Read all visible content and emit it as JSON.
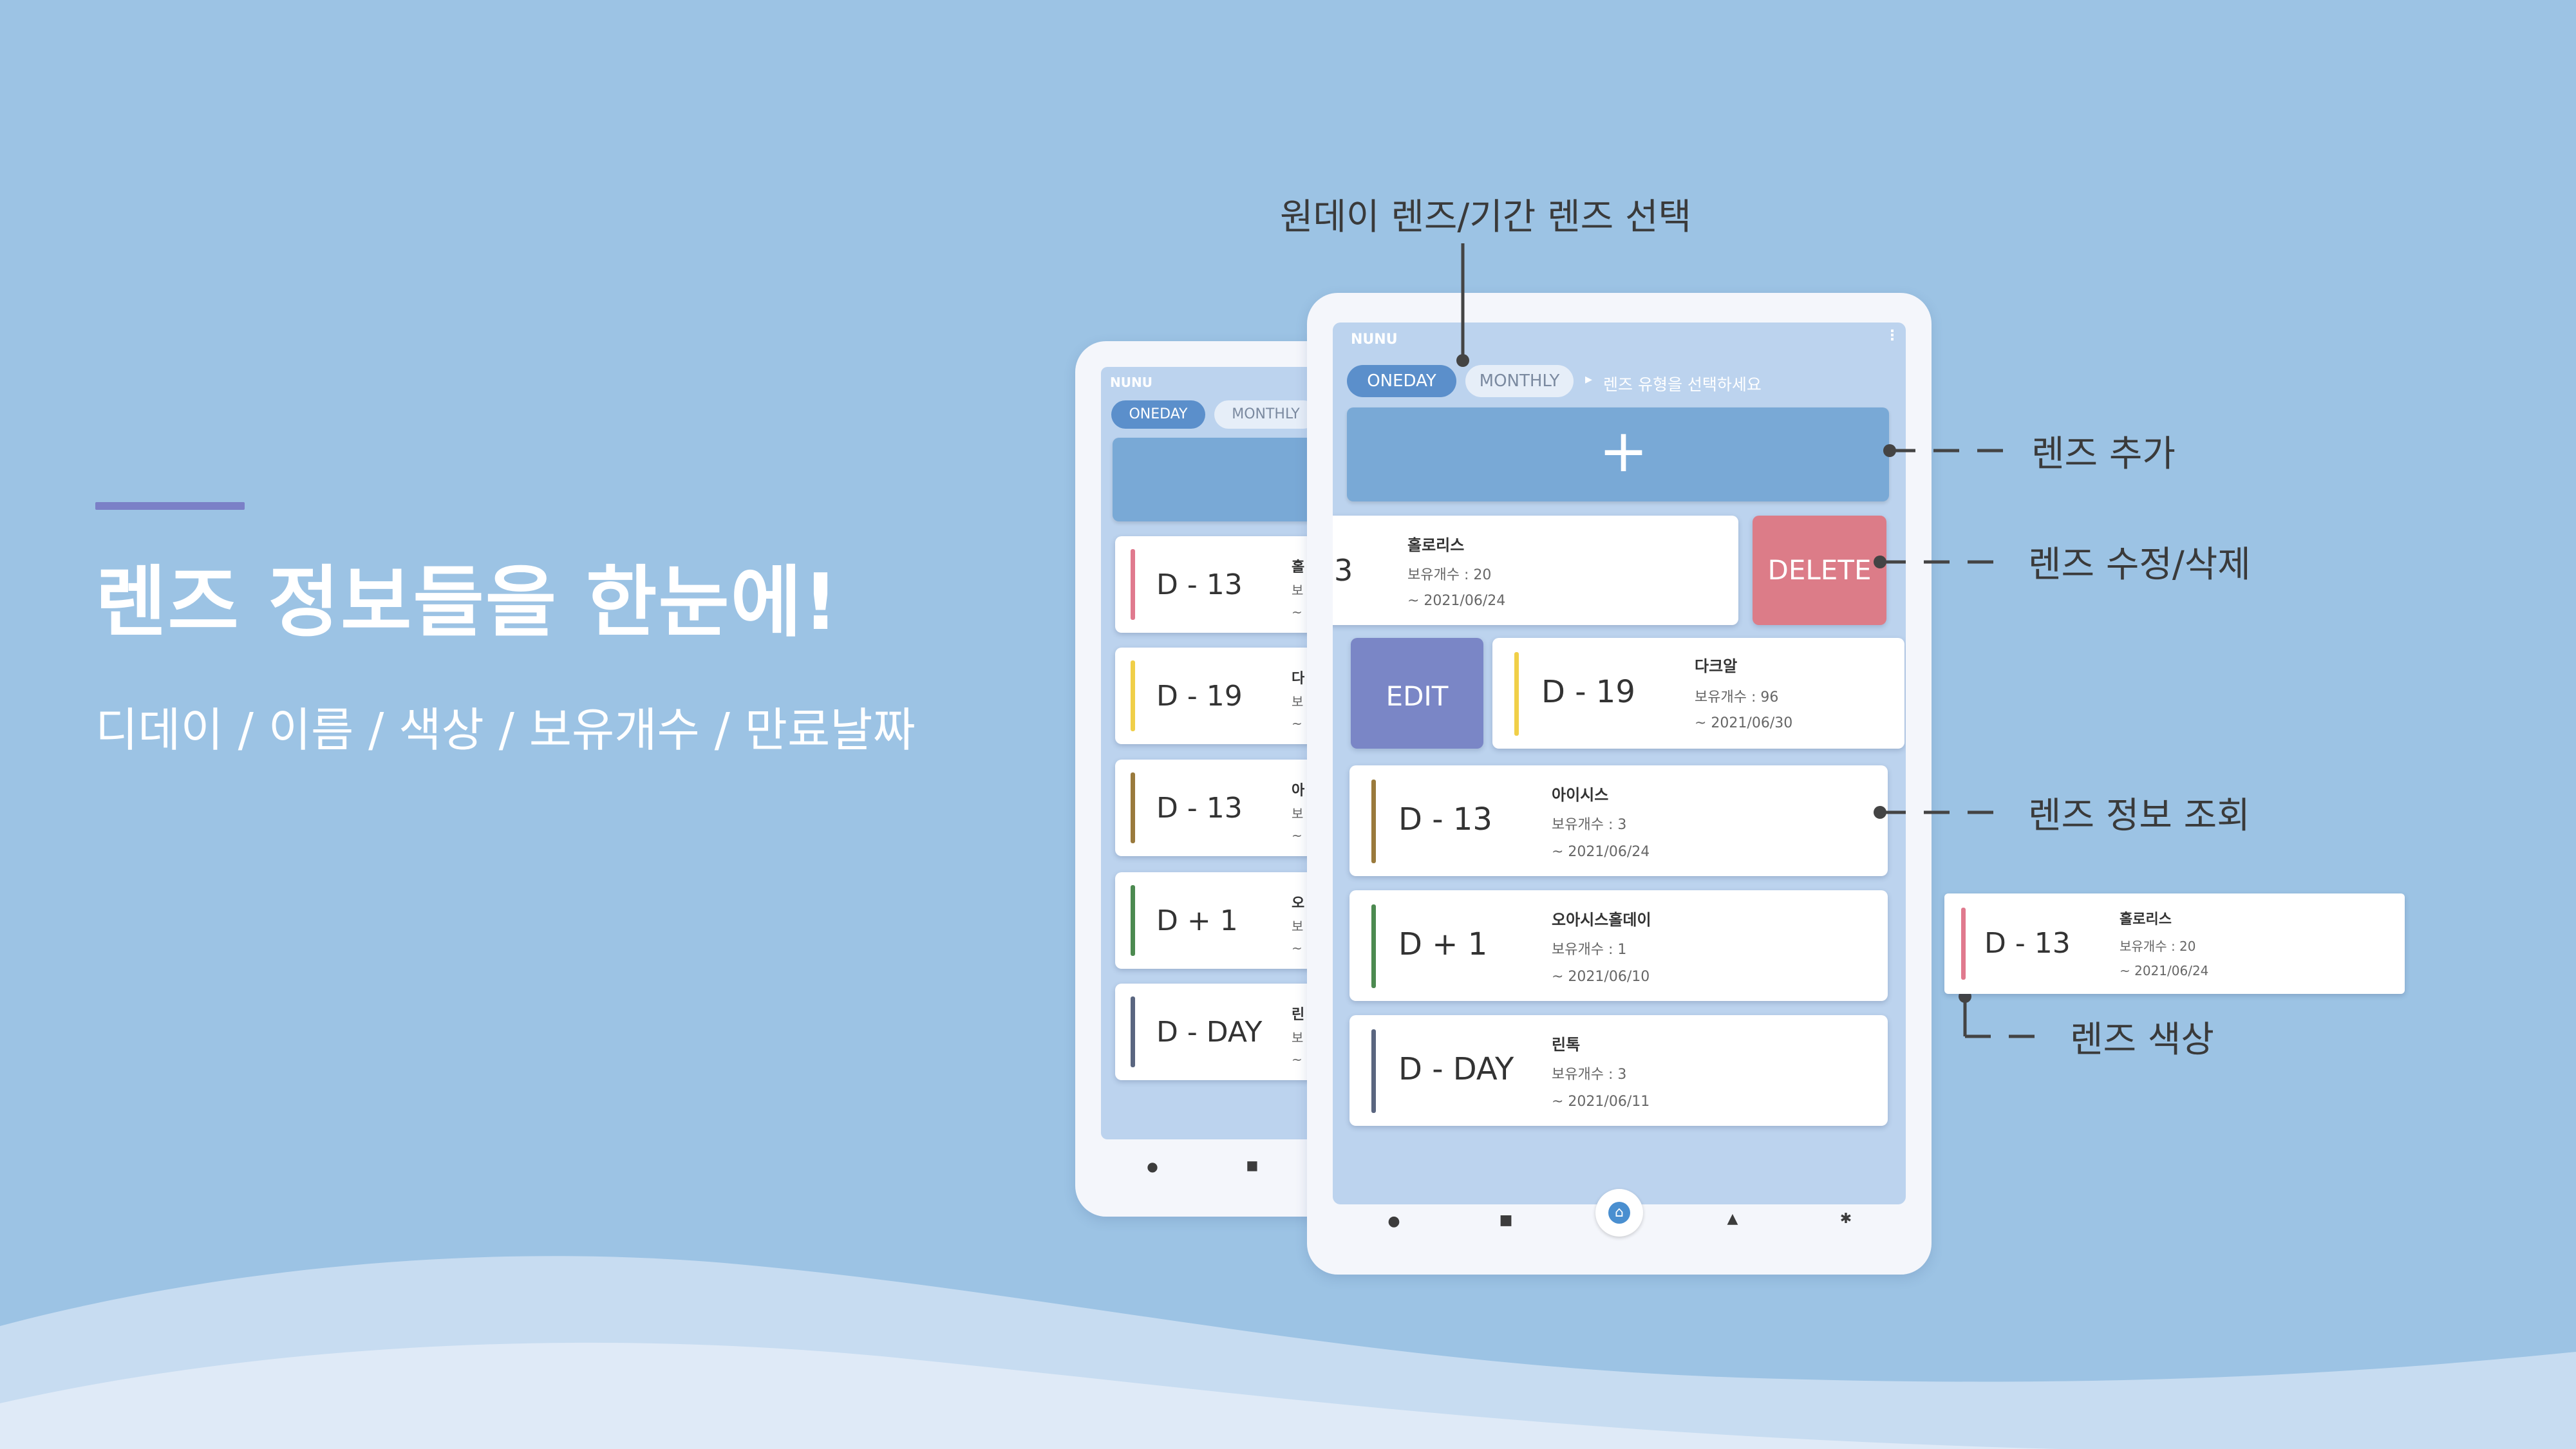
{
  "colors": {
    "background": "#9cc3e4",
    "accent_bar": "#7b80c7",
    "oneday_pill": "#5b8fcb",
    "add_bar": "#79a9d6",
    "delete": "#dc7c88",
    "edit": "#7a86c6"
  },
  "hero": {
    "title": "렌즈 정보들을 한눈에!",
    "subtitle": "디데이 / 이름 / 색상 / 보유개수 / 만료날짜"
  },
  "app": {
    "title": "NUNU",
    "menu_icon": "more-vert-icon",
    "tabs": [
      {
        "label": "ONEDAY",
        "active": true
      },
      {
        "label": "MONTHLY",
        "active": false
      }
    ],
    "hint_arrow": "▸",
    "hint": "렌즈 유형을 선택하세요",
    "add_icon": "plus-icon",
    "add_symbol": "+",
    "delete_label": "DELETE",
    "edit_label": "EDIT",
    "swiped_card": {
      "dday_fragment": "3",
      "name": "홀로리스",
      "count": "보유개수 : 20",
      "expiry": "~   2021/06/24"
    },
    "cards": [
      {
        "dday": "D - 13",
        "name": "홀로리스",
        "count": "보유개수 : 20",
        "expiry": "~   2021/06/24",
        "color": "#e07a8e"
      },
      {
        "dday": "D - 19",
        "name": "다크알",
        "count": "보유개수 : 96",
        "expiry": "~   2021/06/30",
        "color": "#f0cf48"
      },
      {
        "dday": "D - 13",
        "name": "아이시스",
        "count": "보유개수 : 3",
        "expiry": "~   2021/06/24",
        "color": "#9a7a3c"
      },
      {
        "dday": "D + 1",
        "name": "오아시스홀데이",
        "count": "보유개수 : 1",
        "expiry": "~   2021/06/10",
        "color": "#4c8a50"
      },
      {
        "dday": "D - DAY",
        "name": "린톡",
        "count": "보유개수 : 3",
        "expiry": "~   2021/06/11",
        "color": "#5a6680"
      }
    ],
    "back_tablet_name_fragments": [
      "홀",
      "다",
      "아",
      "오",
      "린"
    ],
    "back_tablet_count_fragments": [
      "보",
      "보",
      "보",
      "보",
      "보"
    ],
    "back_tablet_expiry_fragments": [
      "~",
      "~",
      "~",
      "~",
      "~"
    ],
    "nav": [
      {
        "icon": "eye-icon",
        "glyph": "●"
      },
      {
        "icon": "calendar-icon",
        "glyph": "■"
      },
      {
        "icon": "home-icon",
        "glyph": "⌂"
      },
      {
        "icon": "bell-icon",
        "glyph": "▲"
      },
      {
        "icon": "settings-icon",
        "glyph": "✱"
      }
    ]
  },
  "annotations": {
    "type_select": "원데이 렌즈/기간 렌즈 선택",
    "add": "렌즈 추가",
    "edit_delete": "렌즈 수정/삭제",
    "view_info": "렌즈 정보 조회",
    "color": "렌즈 색상"
  },
  "zoom_card": {
    "dday": "D - 13",
    "name": "홀로리스",
    "count": "보유개수 : 20",
    "expiry": "~   2021/06/24",
    "color": "#e07a8e"
  }
}
